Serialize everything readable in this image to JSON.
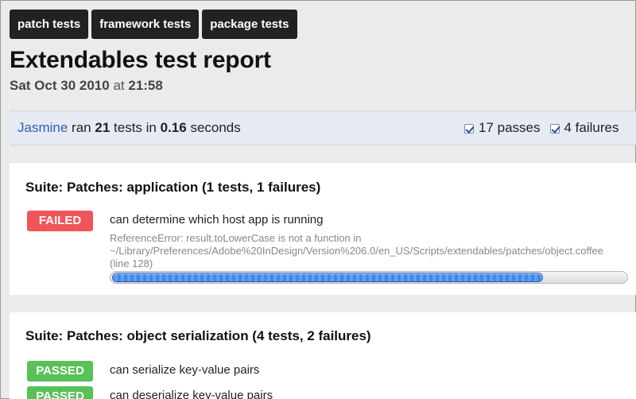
{
  "nav": {
    "tabs": [
      {
        "label": "patch tests"
      },
      {
        "label": "framework tests"
      },
      {
        "label": "package tests"
      }
    ]
  },
  "header": {
    "title": "Extendables test report",
    "date": "Sat Oct 30 2010",
    "at": "at",
    "time": "21:58"
  },
  "summary": {
    "runner": "Jasmine",
    "ran": "ran",
    "test_count": "21",
    "tests_in": "tests in",
    "duration": "0.16",
    "seconds": "seconds",
    "passes": "17 passes",
    "failures": "4 failures"
  },
  "suites": [
    {
      "title": "Suite: Patches: application (1 tests, 1 failures)",
      "tests": [
        {
          "status": "FAILED",
          "name": "can determine which host app is running",
          "error_lines": [
            "ReferenceError: result.toLowerCase is not a function in",
            "~/Library/Preferences/Adobe%20InDesign/Version%206.0/en_US/Scripts/extendables/patches/object.coffee",
            "(line 128)"
          ]
        }
      ]
    },
    {
      "title": "Suite: Patches: object serialization (4 tests, 2 failures)",
      "tests": [
        {
          "status": "PASSED",
          "name": "can serialize key-value pairs"
        },
        {
          "status": "PASSED",
          "name": "can deserialize key-value pairs"
        }
      ]
    }
  ],
  "colors": {
    "failed": "#f0555a",
    "passed": "#58c158",
    "link": "#2a62b8"
  }
}
